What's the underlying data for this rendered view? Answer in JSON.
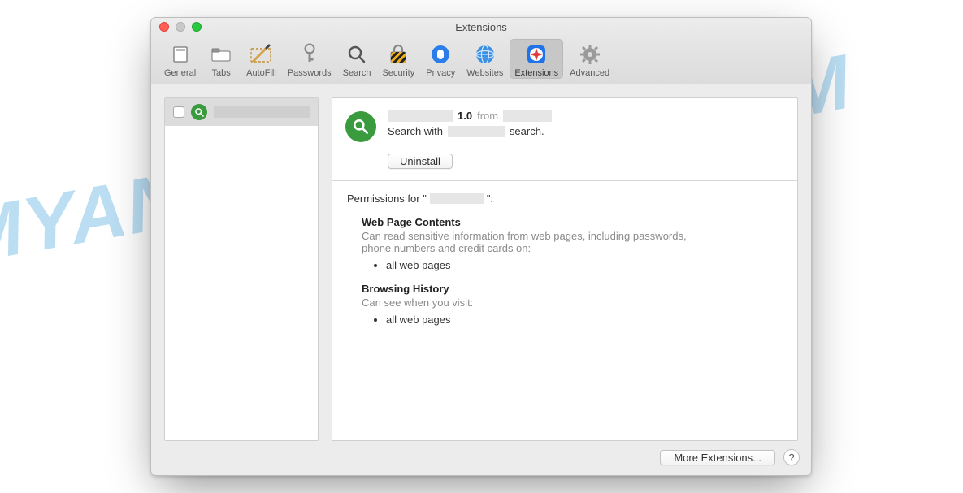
{
  "watermark": "MYANTISPYWARE.COM",
  "window": {
    "title": "Extensions"
  },
  "toolbar": [
    {
      "id": "general",
      "label": "General"
    },
    {
      "id": "tabs",
      "label": "Tabs"
    },
    {
      "id": "autofill",
      "label": "AutoFill"
    },
    {
      "id": "passwords",
      "label": "Passwords"
    },
    {
      "id": "search",
      "label": "Search"
    },
    {
      "id": "security",
      "label": "Security"
    },
    {
      "id": "privacy",
      "label": "Privacy"
    },
    {
      "id": "websites",
      "label": "Websites"
    },
    {
      "id": "extensions",
      "label": "Extensions",
      "active": true
    },
    {
      "id": "advanced",
      "label": "Advanced"
    }
  ],
  "sidebar": {
    "items": [
      {
        "checked": false,
        "name_redacted": true
      }
    ]
  },
  "detail": {
    "version": "1.0",
    "from_label": "from",
    "desc_prefix": "Search with",
    "desc_suffix": "search.",
    "uninstall_label": "Uninstall"
  },
  "permissions": {
    "title_prefix": "Permissions for \"",
    "title_suffix": "\":",
    "blocks": [
      {
        "heading": "Web Page Contents",
        "body": "Can read sensitive information from web pages, including passwords, phone numbers and credit cards on:",
        "bullets": [
          "all web pages"
        ]
      },
      {
        "heading": "Browsing History",
        "body": "Can see when you visit:",
        "bullets": [
          "all web pages"
        ]
      }
    ]
  },
  "footer": {
    "more_label": "More Extensions...",
    "help_label": "?"
  }
}
